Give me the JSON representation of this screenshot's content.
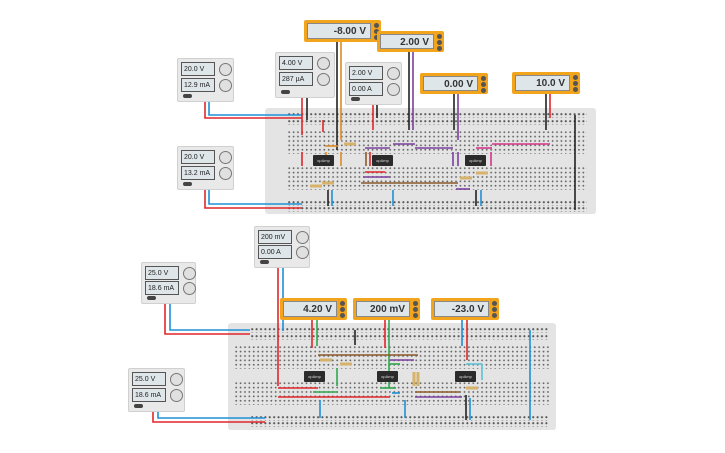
{
  "circuit_top": {
    "supplies": [
      {
        "voltage": "20.0 V",
        "current": "12.9 mA"
      },
      {
        "voltage": "4.00 V",
        "current": "287 µA"
      },
      {
        "voltage": "2.00 V",
        "current": "0.00 A"
      },
      {
        "voltage": "20.0 V",
        "current": "13.2 mA"
      }
    ],
    "meters": [
      "-8.00 V",
      "2.00 V",
      "0.00 V",
      "10.0 V"
    ],
    "chips": [
      "opAmp",
      "opAmp",
      "opAmp"
    ]
  },
  "circuit_bottom": {
    "supplies": [
      {
        "voltage": "200 mV",
        "current": "0.00 A"
      },
      {
        "voltage": "25.0 V",
        "current": "18.6 mA"
      },
      {
        "voltage": "25.0 V",
        "current": "18.6 mA"
      }
    ],
    "meters": [
      "4.20 V",
      "200 mV",
      "-23.0 V"
    ],
    "chips": [
      "opAmp",
      "opAmp",
      "opAmp"
    ]
  },
  "colors": {
    "meter": "#f3a41d",
    "wire_red": "#e0272b",
    "wire_blue": "#1e90d6",
    "wire_purple": "#7b3fa0",
    "wire_brown": "#8b5a2b",
    "wire_pink": "#d6338a",
    "wire_green": "#2fa84f",
    "wire_orange": "#e08a1e"
  }
}
